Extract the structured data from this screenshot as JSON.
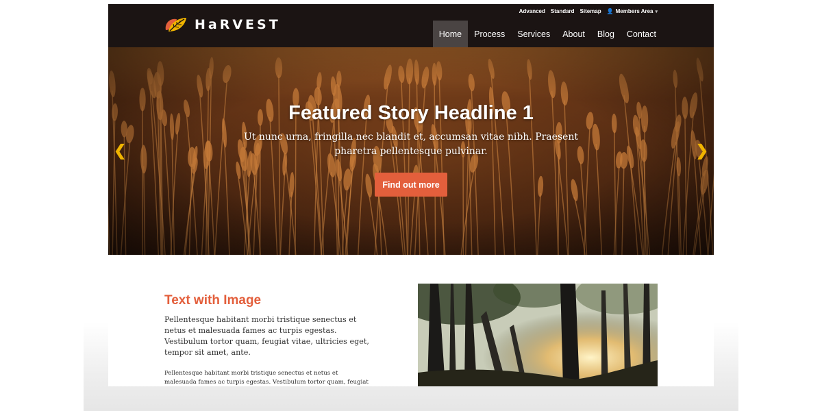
{
  "brand": {
    "name": "HaRVEST",
    "accent_color": "#e35f3c",
    "header_color": "#1b1413"
  },
  "utility_nav": {
    "items": [
      "Advanced",
      "Standard",
      "Sitemap"
    ],
    "members": {
      "label": "Members Area",
      "icon": "user-icon",
      "caret": "chevron-down-icon"
    }
  },
  "main_nav": {
    "items": [
      "Home",
      "Process",
      "Services",
      "About",
      "Blog",
      "Contact"
    ],
    "active": "Home"
  },
  "hero": {
    "title": "Featured Story Headline 1",
    "subtitle": "Ut nunc urna, fringilla nec blandit et, accumsan vitae nibh. Praesent pharetra pellentesque pulvinar.",
    "button_label": "Find out more",
    "prev_icon": "chevron-left-icon",
    "next_icon": "chevron-right-icon",
    "arrow_color": "#f0b400"
  },
  "section": {
    "title": "Text with Image",
    "lead": "Pellentesque habitant morbi tristique senectus et netus et malesuada fames ac turpis egestas. Vestibulum tortor quam, feugiat vitae, ultricies eget, tempor sit amet, ante.",
    "body": "Pellentesque habitant morbi tristique senectus et netus et malesuada fames ac turpis egestas. Vestibulum tortor quam, feugiat vitae, ultricies eget, tempor sit amet, ante."
  }
}
